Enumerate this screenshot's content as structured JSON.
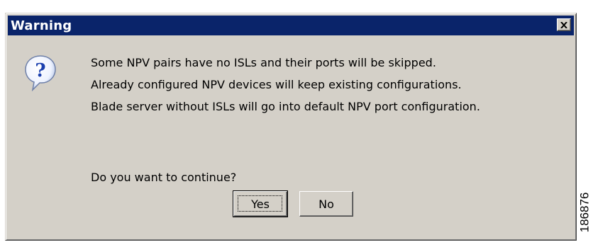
{
  "dialog": {
    "title": "Warning",
    "close_icon": "close-icon",
    "icon": "question-icon",
    "message_lines": [
      "Some NPV pairs have no ISLs and their ports will be skipped.",
      "Already configured NPV devices will keep existing configurations.",
      "Blade server without ISLs will go into default NPV port configuration."
    ],
    "prompt": "Do you want to continue?",
    "buttons": {
      "yes": "Yes",
      "no": "No"
    }
  },
  "figure_id": "186876",
  "colors": {
    "titlebar": "#0a246a",
    "dialog_bg": "#d4d0c8",
    "icon_bubble": "#ffffff",
    "icon_mark": "#1a3fae"
  }
}
